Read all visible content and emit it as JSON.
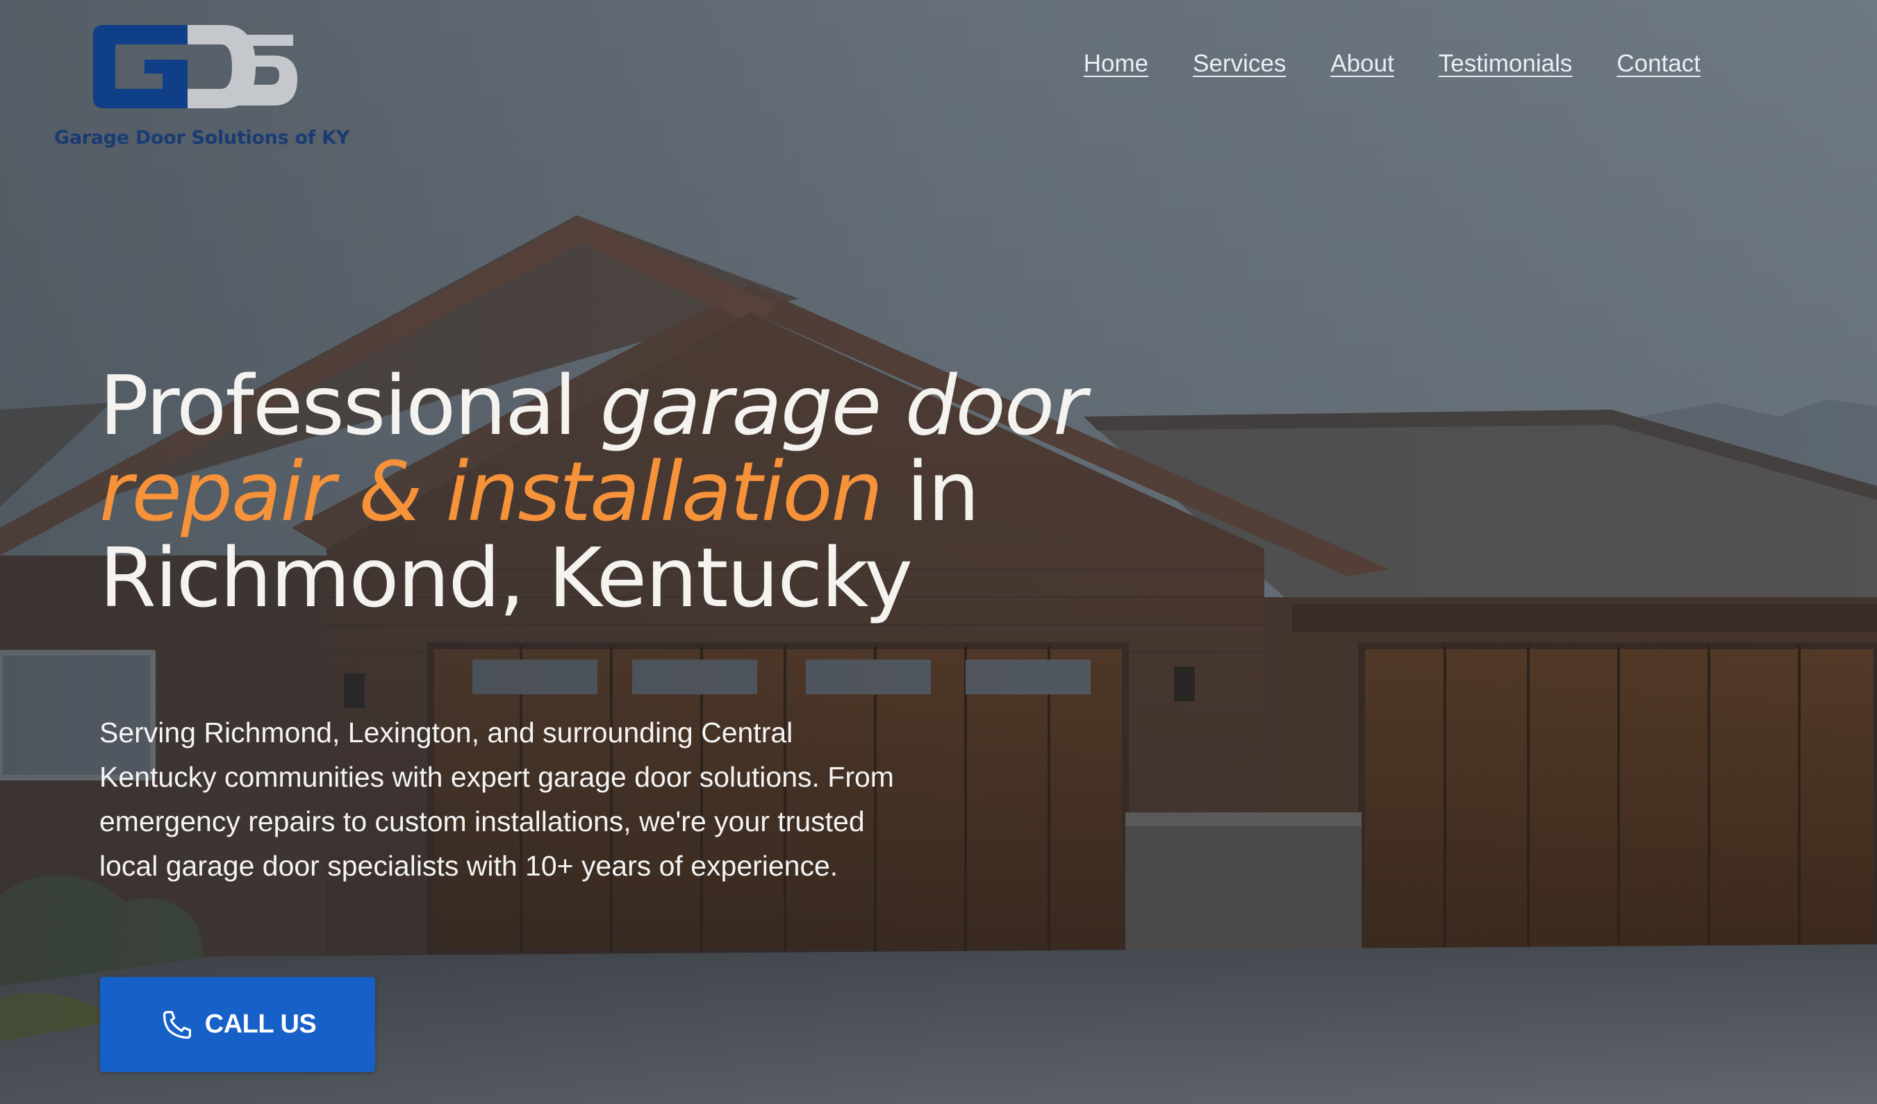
{
  "brand": {
    "logo_letters": "GDS",
    "name": "Garage Door Solutions of KY",
    "logo_primary_color": "#0f3f86",
    "logo_secondary_color": "#c4c8cc"
  },
  "nav": {
    "items": [
      {
        "label": "Home"
      },
      {
        "label": "Services"
      },
      {
        "label": "About"
      },
      {
        "label": "Testimonials"
      },
      {
        "label": "Contact"
      }
    ]
  },
  "hero": {
    "headline_part1": "Professional ",
    "headline_part2": "garage door",
    "headline_accent": "repair & installation",
    "headline_part3": " in",
    "headline_part4": "Richmond, Kentucky",
    "accent_color": "#f5923a",
    "description": "Serving Richmond, Lexington, and surrounding Central Kentucky communities with expert garage door solutions. From emergency repairs to custom installations, we're your trusted local garage door specialists with 10+ years of experience.",
    "cta_label": "CALL US",
    "cta_icon": "phone-icon",
    "cta_color": "#1660c8"
  }
}
